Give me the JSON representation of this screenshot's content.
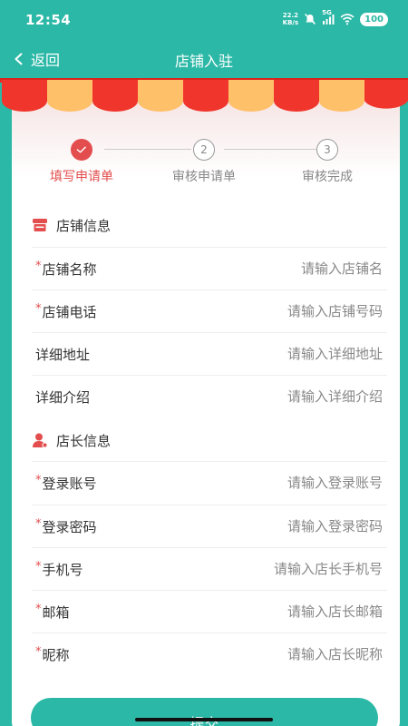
{
  "status_bar": {
    "time": "12:54",
    "net_speed_value": "22.2",
    "net_speed_unit": "KB/s",
    "signal_label": "5G",
    "battery": "100",
    "icons": [
      "mute-icon",
      "signal-icon",
      "wifi-icon",
      "battery-icon"
    ]
  },
  "header": {
    "back_label": "返回",
    "title": "店铺入驻"
  },
  "steps": [
    {
      "number": "1",
      "label": "填写申请单",
      "state": "done"
    },
    {
      "number": "2",
      "label": "审核申请单",
      "state": "todo"
    },
    {
      "number": "3",
      "label": "审核完成",
      "state": "todo"
    }
  ],
  "shop_section": {
    "title": "店铺信息",
    "icon": "shop-icon",
    "fields": [
      {
        "label": "店铺名称",
        "required": true,
        "placeholder": "请输入店铺名",
        "value": ""
      },
      {
        "label": "店铺电话",
        "required": true,
        "placeholder": "请输入店铺号码",
        "value": ""
      },
      {
        "label": "详细地址",
        "required": false,
        "placeholder": "请输入详细地址",
        "value": ""
      },
      {
        "label": "详细介绍",
        "required": false,
        "placeholder": "请输入详细介绍",
        "value": ""
      }
    ]
  },
  "owner_section": {
    "title": "店长信息",
    "icon": "user-icon",
    "fields": [
      {
        "label": "登录账号",
        "required": true,
        "placeholder": "请输入登录账号",
        "value": ""
      },
      {
        "label": "登录密码",
        "required": true,
        "placeholder": "请输入登录密码",
        "value": ""
      },
      {
        "label": "手机号",
        "required": true,
        "placeholder": "请输入店长手机号",
        "value": ""
      },
      {
        "label": "邮箱",
        "required": true,
        "placeholder": "请输入店长邮箱",
        "value": ""
      },
      {
        "label": "昵称",
        "required": true,
        "placeholder": "请输入店长昵称",
        "value": ""
      }
    ]
  },
  "required_mark": "*",
  "submit_label": "提交",
  "colors": {
    "brand": "#2bb8a6",
    "accent": "#e34d4d",
    "awning_red": "#f0362c",
    "awning_orange": "#ffc06a"
  }
}
